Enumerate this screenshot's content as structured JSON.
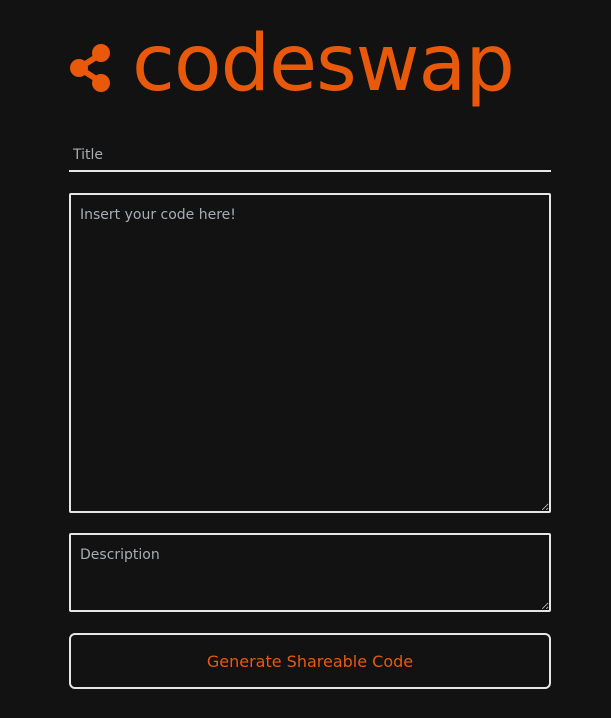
{
  "brand": {
    "name": "codeswap",
    "icon": "share-icon",
    "color": "#e8590c"
  },
  "form": {
    "title_placeholder": "Title",
    "code_placeholder": "Insert your code here!",
    "description_placeholder": "Description",
    "submit_label": "Generate Shareable Code",
    "submit_color": "#e8590c",
    "border_color": "#e6e6e6",
    "background": "#121212"
  }
}
